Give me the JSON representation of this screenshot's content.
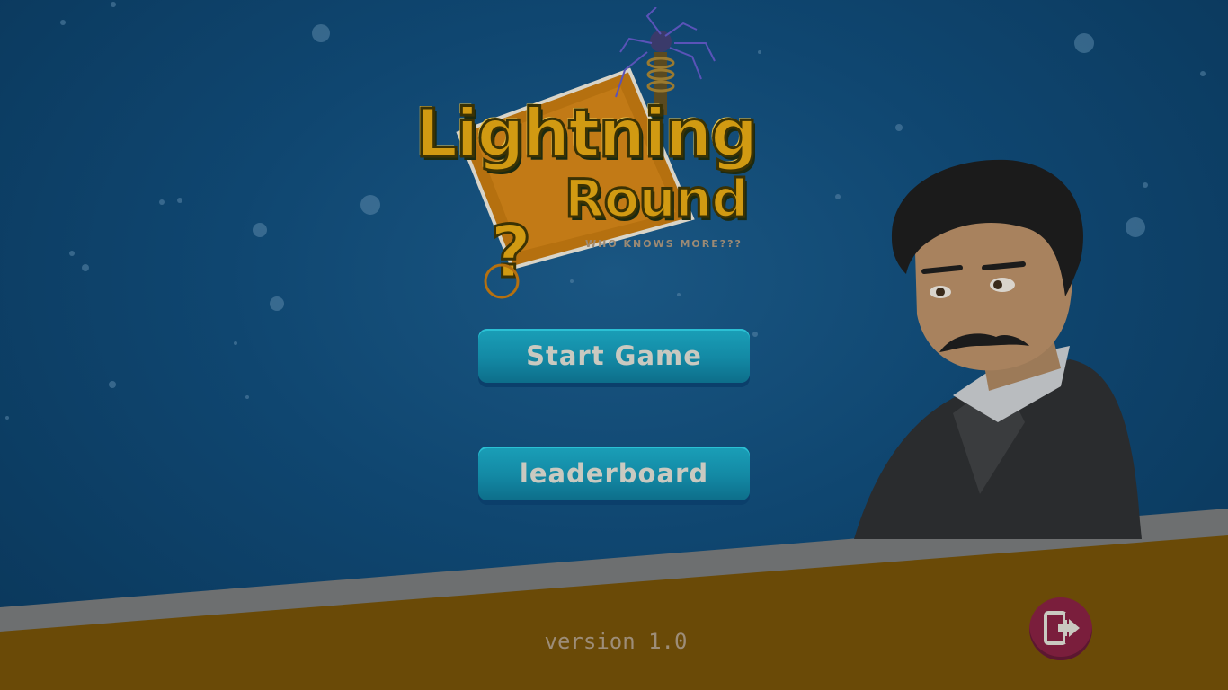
{
  "logo": {
    "title": "Lightning",
    "subtitle": "Round",
    "tagline": "WHO KNOWS MORE???"
  },
  "menu": {
    "start_label": "Start Game",
    "leaderboard_label": "leaderboard"
  },
  "footer": {
    "version": "version 1.0"
  },
  "icons": {
    "exit": "exit-door-icon"
  },
  "colors": {
    "sky": "#0f4670",
    "ground": "#6a4a07",
    "button": "#1389a4",
    "exit_button": "#7a1e3c",
    "logo_gold": "#d19a12"
  }
}
